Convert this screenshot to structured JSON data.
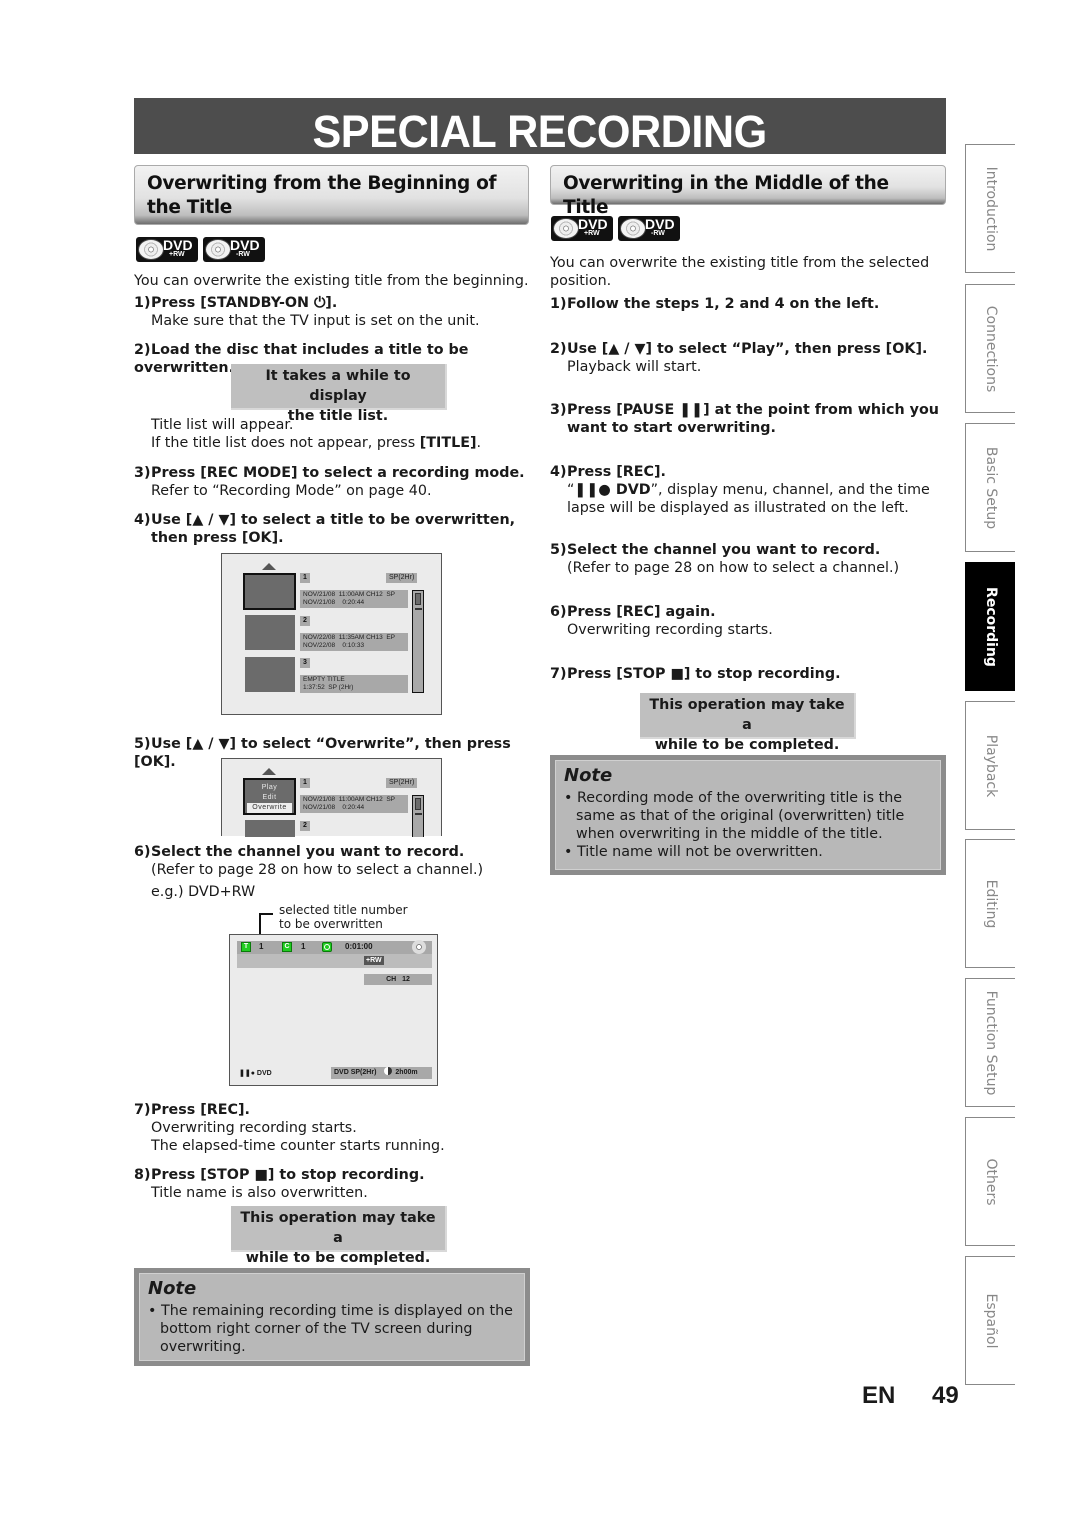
{
  "page_title": "SPECIAL RECORDING",
  "left": {
    "heading": "Overwriting from the Beginning of the Title",
    "badges": [
      {
        "label": "DVD",
        "sub": "+RW",
        "icon": "disc-icon"
      },
      {
        "label": "DVD",
        "sub": "-RW",
        "icon": "disc-icon"
      }
    ],
    "intro": "You can overwrite the existing title from the beginning.",
    "steps": [
      {
        "num": "1)",
        "head": "Press [STANDBY-ON ⏻].",
        "body": [
          "Make sure that the TV input is set on the unit."
        ]
      },
      {
        "num": "2)",
        "head": "Load the disc that includes a title to be overwritten.",
        "callout": [
          "It takes a while to display",
          "the title list."
        ],
        "body": [
          "Title list will appear.",
          "If the title list does not appear, press [TITLE]."
        ]
      },
      {
        "num": "3)",
        "head": "Press [REC MODE] to select a recording mode.",
        "body": [
          "Refer to “Recording Mode” on page 40."
        ]
      },
      {
        "num": "4)",
        "head": "Use [▲ / ▼] to select a title to be overwritten, then press [OK]."
      },
      {
        "num": "5)",
        "head": "Use [▲ / ▼] to select “Overwrite”, then press [OK]."
      },
      {
        "num": "6)",
        "head": "Select the channel you want to record.",
        "body": [
          "(Refer to page 28 on how to select a channel.)",
          "e.g.) DVD+RW"
        ]
      },
      {
        "num": "7)",
        "head": "Press [REC].",
        "body": [
          "Overwriting recording starts.",
          "The elapsed-time counter starts running."
        ]
      },
      {
        "num": "8)",
        "head": "Press [STOP ■] to stop recording.",
        "body": [
          "Title name is also overwritten."
        ],
        "callout": [
          "This operation may take a",
          "while to be completed."
        ]
      }
    ],
    "title_list_screen": {
      "sp_label": "SP(2Hr)",
      "items": [
        {
          "num": "1",
          "line1": "NOV/21/08  11:00AM CH12  SP",
          "line2": "NOV/21/08    0:20:44"
        },
        {
          "num": "2",
          "line1": "NOV/22/08  11:35AM CH13  EP",
          "line2": "NOV/22/08    0:10:33"
        },
        {
          "num": "3",
          "line1": "EMPTY TITLE",
          "line2": "1:37:52  SP (2Hr)"
        }
      ]
    },
    "overwrite_menu_screen": {
      "menu_options": [
        "Play",
        "Edit",
        "Overwrite"
      ],
      "selected_option": "Overwrite"
    },
    "recording_screen": {
      "annotation": [
        "selected title number",
        "to be overwritten"
      ],
      "title_icon": "T",
      "title_num": "1",
      "chapter_icon": "C",
      "chapter_num": "1",
      "elapsed": "0:01:00",
      "disc_type": "+RW",
      "channel": "CH   12",
      "status": "DVD",
      "mode": "DVD SP(2Hr)",
      "remaining": "2h00m"
    },
    "note": {
      "title": "Note",
      "items": [
        "The remaining recording time is displayed on the bottom right corner of the TV screen during overwriting."
      ]
    }
  },
  "right": {
    "heading": "Overwriting in the Middle of the Title",
    "badges": [
      {
        "label": "DVD",
        "sub": "+RW",
        "icon": "disc-icon"
      },
      {
        "label": "DVD",
        "sub": "-RW",
        "icon": "disc-icon"
      }
    ],
    "intro": "You can overwrite the existing title from the selected position.",
    "steps": [
      {
        "num": "1)",
        "head": "Follow the steps 1, 2 and 4 on the left."
      },
      {
        "num": "2)",
        "head": "Use [▲ / ▼] to select “Play”, then press [OK].",
        "body": [
          "Playback will start."
        ]
      },
      {
        "num": "3)",
        "head": "Press [PAUSE ❚❚] at the point from which you want to start overwriting."
      },
      {
        "num": "4)",
        "head": "Press [REC].",
        "body_rich": {
          "quote_bold": "❚❚● DVD",
          "rest": "”, display menu, channel, and the time lapse will be displayed as illustrated on the left."
        }
      },
      {
        "num": "5)",
        "head": "Select the channel you want to record.",
        "body": [
          "(Refer to page 28 on how to select a channel.)"
        ]
      },
      {
        "num": "6)",
        "head": "Press [REC] again.",
        "body": [
          "Overwriting recording starts."
        ]
      },
      {
        "num": "7)",
        "head": "Press [STOP ■] to stop recording.",
        "callout": [
          "This operation may take a",
          "while to be completed."
        ]
      }
    ],
    "note": {
      "title": "Note",
      "items": [
        "Recording mode of the overwriting title is the same as that of the original (overwritten) title when overwriting in the middle of the title.",
        "Title name will not be overwritten."
      ]
    }
  },
  "sidebar": {
    "tabs": [
      {
        "label": "Introduction",
        "active": false
      },
      {
        "label": "Connections",
        "active": false
      },
      {
        "label": "Basic Setup",
        "active": false
      },
      {
        "label": "Recording",
        "active": true
      },
      {
        "label": "Playback",
        "active": false
      },
      {
        "label": "Editing",
        "active": false
      },
      {
        "label": "Function Setup",
        "active": false
      },
      {
        "label": "Others",
        "active": false
      },
      {
        "label": "Español",
        "active": false
      }
    ]
  },
  "footer": {
    "lang": "EN",
    "page": "49"
  },
  "colors": {
    "banner": "#4d4d4d",
    "callout": "#bfbfbf",
    "note_border": "#8c8c8c",
    "note_bg": "#b8b8b8",
    "active_tab": "#000000",
    "osd_green": "#22cc22"
  }
}
